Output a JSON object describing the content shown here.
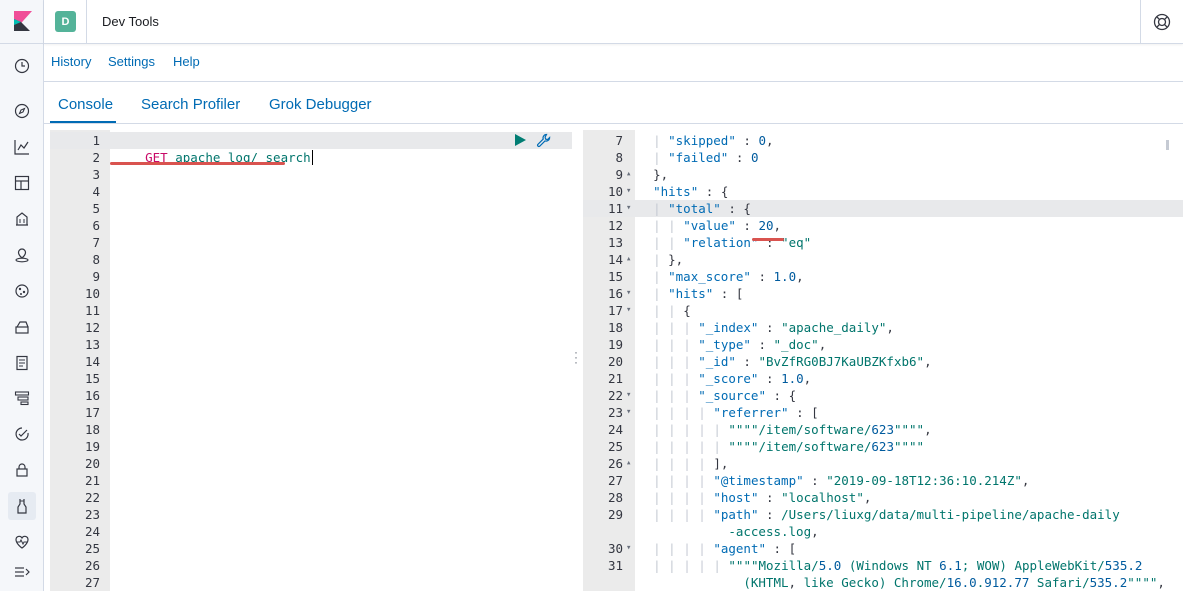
{
  "header": {
    "avatar_letter": "D",
    "app_title": "Dev Tools"
  },
  "submenu": [
    "History",
    "Settings",
    "Help"
  ],
  "tabs": [
    "Console",
    "Search Profiler",
    "Grok Debugger"
  ],
  "rail_icons": [
    "clock-icon",
    "compass-icon",
    "visualize-icon",
    "dashboard-icon",
    "canvas-icon",
    "maps-icon",
    "ml-icon",
    "infra-icon",
    "logs-icon",
    "apm-icon",
    "uptime-icon",
    "security-icon",
    "devtools-icon",
    "monitoring-icon",
    "collapse-icon"
  ],
  "request_editor": {
    "line_numbers": [
      "1",
      "2",
      "3",
      "4",
      "5",
      "6",
      "7",
      "8",
      "9",
      "10",
      "11",
      "12",
      "13",
      "14",
      "15",
      "16",
      "17",
      "18",
      "19",
      "20",
      "21",
      "22",
      "23",
      "24",
      "25",
      "26",
      "27"
    ],
    "method": "GET",
    "path": "apache_log/_search"
  },
  "response_editor": {
    "line_numbers": [
      "7",
      "8",
      "9",
      "10",
      "11",
      "12",
      "13",
      "14",
      "15",
      "16",
      "17",
      "18",
      "19",
      "20",
      "21",
      "22",
      "23",
      "24",
      "25",
      "26",
      "27",
      "28",
      "29",
      "",
      "30",
      "31"
    ],
    "fold_markers": [
      "",
      "",
      "▴",
      "▾",
      "▾",
      "",
      "",
      "▴",
      "",
      "▾",
      "▾",
      "",
      "",
      "",
      "",
      "▾",
      "▾",
      "",
      "",
      "▴",
      "",
      "",
      "",
      "",
      "▾",
      ""
    ],
    "lines": [
      "  | \"skipped\" : 0,",
      "  | \"failed\" : 0",
      "  },",
      "  \"hits\" : {",
      "  | \"total\" : {",
      "  | | \"value\" : 20,",
      "  | | \"relation\" : \"eq\"",
      "  | },",
      "  | \"max_score\" : 1.0,",
      "  | \"hits\" : [",
      "  | | {",
      "  | | | \"_index\" : \"apache_daily\",",
      "  | | | \"_type\" : \"_doc\",",
      "  | | | \"_id\" : \"BvZfRG0BJ7KaUBZKfxb6\",",
      "  | | | \"_score\" : 1.0,",
      "  | | | \"_source\" : {",
      "  | | | | \"referrer\" : [",
      "  | | | | | \"\"\"\"/item/software/623\"\"\"\",",
      "  | | | | | \"\"\"\"/item/software/623\"\"\"\"",
      "  | | | | ],",
      "  | | | | \"@timestamp\" : \"2019-09-18T12:36:10.214Z\",",
      "  | | | | \"host\" : \"localhost\",",
      "  | | | | \"path\" : \"/Users/liuxg/data/multi-pipeline/apache-daily",
      "            -access.log\",",
      "  | | | | \"agent\" : [",
      "  | | | | | \"\"\"\"Mozilla/5.0 (Windows NT 6.1; WOW64) AppleWebKit/535.2"
    ],
    "extra_line": "              (KHTML, like Gecko) Chrome/16.0.912.77 Safari/535.2\"\"\"\","
  }
}
